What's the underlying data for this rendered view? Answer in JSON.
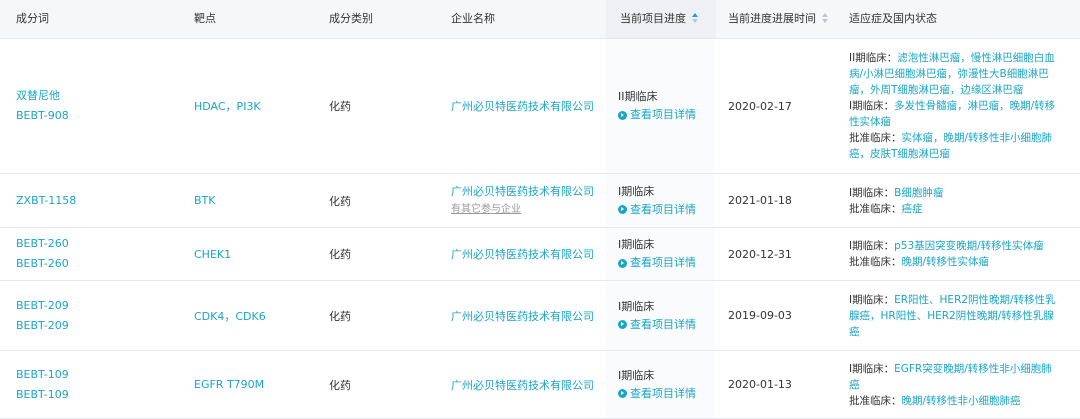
{
  "headers": {
    "ingredient": "成分词",
    "target": "靶点",
    "category": "成分类别",
    "company": "企业名称",
    "progress": "当前项目进度",
    "time": "当前进度进展时间",
    "indication": "适应症及国内状态"
  },
  "detail_label": "查看项目详情",
  "rows": [
    {
      "names": [
        "双替尼他",
        "BEBT-908"
      ],
      "target": "HDAC，PI3K",
      "category": "化药",
      "company": "广州必贝特医药技术有限公司",
      "company_sub": "",
      "progress": "II期临床",
      "time": "2020-02-17",
      "indications": [
        {
          "label": "II期临床：",
          "value": "滤泡性淋巴瘤，慢性淋巴细胞白血病/小淋巴细胞淋巴瘤，弥漫性大B细胞淋巴瘤，外周T细胞淋巴瘤，边缘区淋巴瘤"
        },
        {
          "label": "I期临床：",
          "value": "多发性骨髓瘤，淋巴瘤，晚期/转移性实体瘤"
        },
        {
          "label": "批准临床：",
          "value": "实体瘤，晚期/转移性非小细胞肺癌，皮肤T细胞淋巴瘤"
        }
      ]
    },
    {
      "names": [
        "ZXBT-1158"
      ],
      "target": "BTK",
      "category": "化药",
      "company": "广州必贝特医药技术有限公司",
      "company_sub": "有其它参与企业",
      "progress": "I期临床",
      "time": "2021-01-18",
      "indications": [
        {
          "label": "I期临床：",
          "value": "B细胞肿瘤"
        },
        {
          "label": "批准临床：",
          "value": "癌症"
        }
      ]
    },
    {
      "names": [
        "BEBT-260",
        "BEBT-260"
      ],
      "target": "CHEK1",
      "category": "化药",
      "company": "广州必贝特医药技术有限公司",
      "company_sub": "",
      "progress": "I期临床",
      "time": "2020-12-31",
      "indications": [
        {
          "label": "I期临床：",
          "value": "p53基因突变晚期/转移性实体瘤"
        },
        {
          "label": "批准临床：",
          "value": "晚期/转移性实体瘤"
        }
      ]
    },
    {
      "names": [
        "BEBT-209",
        "BEBT-209"
      ],
      "target": "CDK4，CDK6",
      "category": "化药",
      "company": "广州必贝特医药技术有限公司",
      "company_sub": "",
      "progress": "I期临床",
      "time": "2019-09-03",
      "indications": [
        {
          "label": "I期临床：",
          "value": "ER阳性、HER2阴性晚期/转移性乳腺癌，HR阳性、HER2阴性晚期/转移性乳腺癌"
        }
      ]
    },
    {
      "names": [
        "BEBT-109",
        "BEBT-109"
      ],
      "target": "EGFR T790M",
      "category": "化药",
      "company": "广州必贝特医药技术有限公司",
      "company_sub": "",
      "progress": "I期临床",
      "time": "2020-01-13",
      "indications": [
        {
          "label": "I期临床：",
          "value": "EGFR突变晚期/转移性非小细胞肺癌"
        },
        {
          "label": "批准临床：",
          "value": "晚期/转移性非小细胞肺癌"
        }
      ]
    }
  ]
}
